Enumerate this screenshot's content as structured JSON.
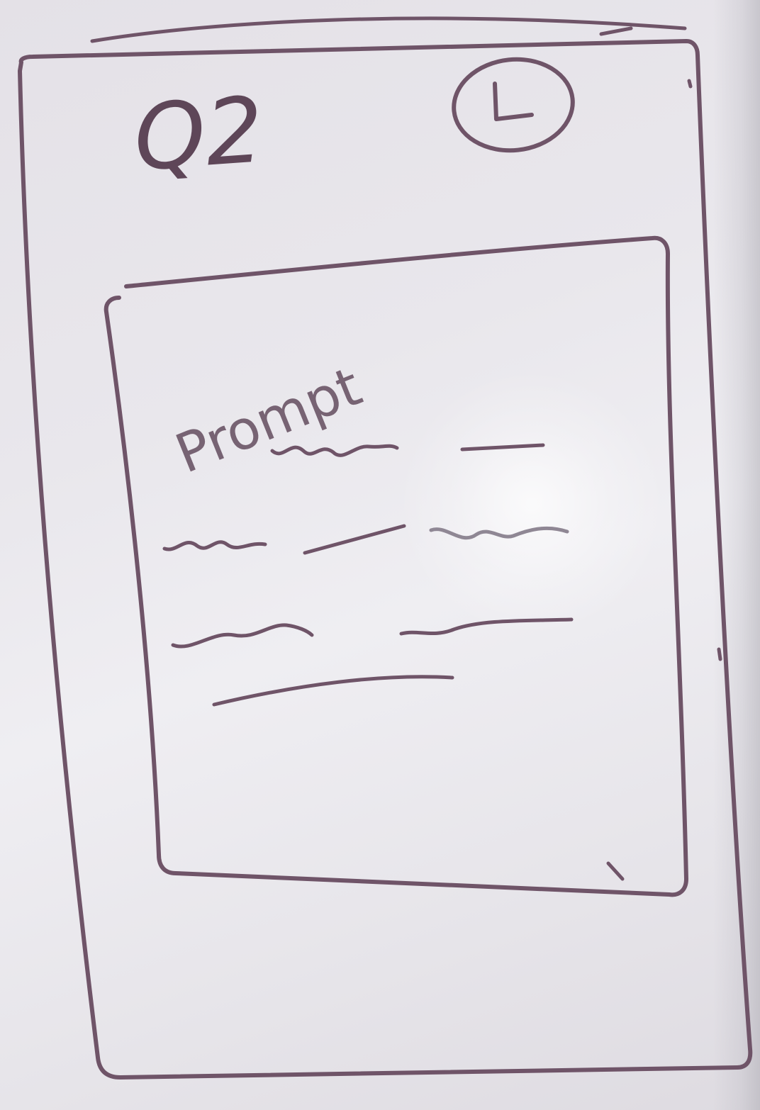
{
  "sketch": {
    "header": {
      "question_label": "Q2",
      "timer_icon": "clock-icon"
    },
    "prompt_card": {
      "prompt_label": "Prompt",
      "placeholder_lines": 8
    }
  }
}
